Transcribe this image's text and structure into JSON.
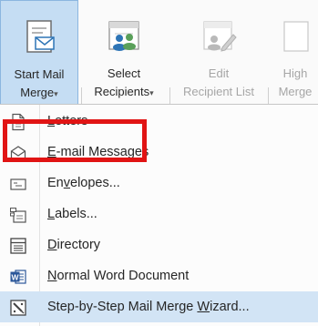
{
  "ribbon": {
    "start_mail_merge": {
      "line1": "Start Mail",
      "line2": "Merge",
      "caret": "▾"
    },
    "select_recipients": {
      "line1": "Select",
      "line2": "Recipients",
      "caret": "▾"
    },
    "edit_recipient_list": {
      "line1": "Edit",
      "line2": "Recipient List"
    },
    "highlight_merge_fields": {
      "line1": "High",
      "line2": "Merge"
    }
  },
  "menu": {
    "items": [
      {
        "pre": "",
        "ul": "L",
        "post": "etters",
        "icon": "letter-icon"
      },
      {
        "pre": "",
        "ul": "E",
        "post": "-mail Messages",
        "icon": "envelope-open-icon"
      },
      {
        "pre": "En",
        "ul": "v",
        "post": "elopes...",
        "icon": "envelope-icon"
      },
      {
        "pre": "",
        "ul": "L",
        "post": "abels...",
        "icon": "labels-icon"
      },
      {
        "pre": "",
        "ul": "D",
        "post": "irectory",
        "icon": "directory-icon"
      },
      {
        "pre": "",
        "ul": "N",
        "post": "ormal Word Document",
        "icon": "word-icon"
      },
      {
        "pre": "Step-by-Step Mail Merge ",
        "ul": "W",
        "post": "izard...",
        "icon": "wizard-icon"
      }
    ]
  },
  "highlight_color": "#e11414",
  "accent_color": "#c5ddf3"
}
